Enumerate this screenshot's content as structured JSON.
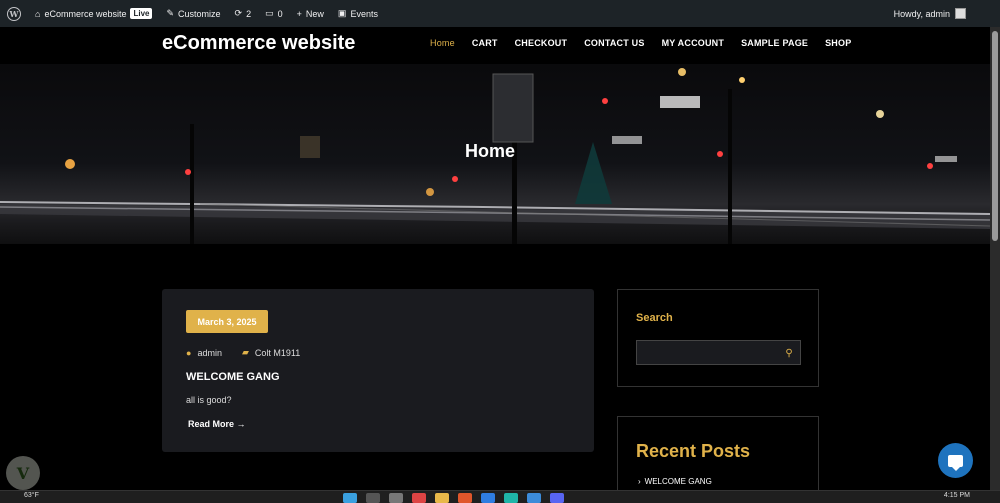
{
  "adminbar": {
    "site_name": "eCommerce website",
    "live_badge": "Live",
    "customize": "Customize",
    "updates_count": "2",
    "comments_count": "0",
    "new_label": "New",
    "events_label": "Events",
    "howdy": "Howdy, admin"
  },
  "header": {
    "site_title": "eCommerce website",
    "nav": [
      "Home",
      "CART",
      "CHECKOUT",
      "CONTACT US",
      "MY ACCOUNT",
      "SAMPLE PAGE",
      "SHOP"
    ],
    "active": "Home"
  },
  "hero": {
    "title": "Home"
  },
  "post": {
    "date": "March 3, 2025",
    "author": "admin",
    "category": "Colt M1911",
    "title": "WELCOME GANG",
    "excerpt": "all is good?",
    "read_more": "Read More"
  },
  "sidebar": {
    "search_title": "Search",
    "search_value": "",
    "recent_title": "Recent Posts",
    "recent_posts": [
      "WELCOME GANG"
    ]
  },
  "taskbar": {
    "weather": "63°F",
    "clock": "4:15 PM"
  },
  "colors": {
    "accent": "#e0b24a",
    "background": "#000000",
    "card": "#1a1b1f",
    "adminbar": "#1d2327",
    "chat": "#1e73be"
  }
}
